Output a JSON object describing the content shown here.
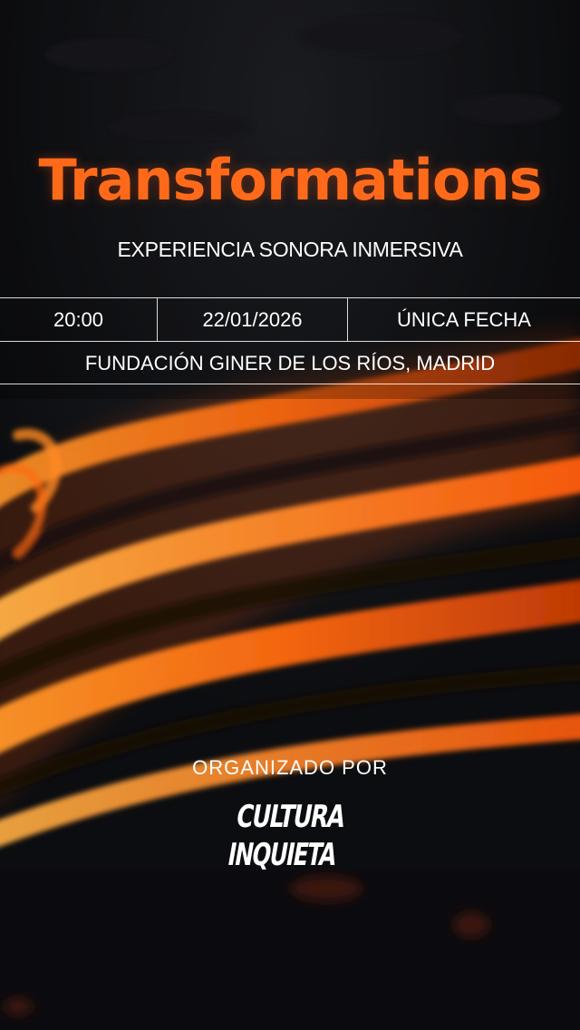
{
  "event": {
    "title": "Transformations",
    "subtitle": "EXPERIENCIA SONORA INMERSIVA",
    "time": "20:00",
    "date": "22/01/2026",
    "note": "ÚNICA FECHA",
    "venue": "FUNDACIÓN GINER DE LOS RÍOS, MADRID"
  },
  "organizer": {
    "label": "ORGANIZADO POR",
    "logo_line1": "CULTURA",
    "logo_line2": "INQUIETA"
  },
  "colors": {
    "accent": "#ff6a1a",
    "background": "#0d0e11",
    "text": "#ffffff"
  }
}
